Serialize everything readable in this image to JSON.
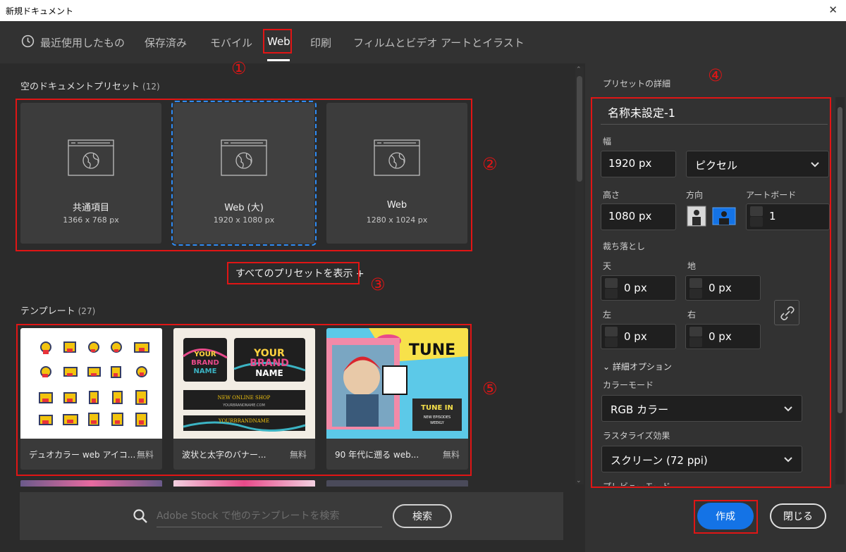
{
  "window": {
    "title": "新規ドキュメント",
    "close_glyph": "✕"
  },
  "tabs": [
    {
      "label": "最近使用したもの",
      "icon": "clock-icon"
    },
    {
      "label": "保存済み"
    },
    {
      "label": "モバイル"
    },
    {
      "label": "Web",
      "active": true
    },
    {
      "label": "印刷"
    },
    {
      "label": "フィルムとビデオ"
    },
    {
      "label": "アートとイラスト"
    }
  ],
  "presets": {
    "heading": "空のドキュメントプリセット",
    "count": "(12)",
    "items": [
      {
        "name": "共通項目",
        "size": "1366 x 768 px"
      },
      {
        "name": "Web (大)",
        "size": "1920 x 1080 px",
        "selected": true
      },
      {
        "name": "Web",
        "size": "1280 x 1024 px"
      }
    ],
    "show_all": "すべてのプリセットを表示 +"
  },
  "templates": {
    "heading": "テンプレート",
    "count": "(27)",
    "items": [
      {
        "name": "デュオカラー web アイコ...",
        "price": "無料"
      },
      {
        "name": "波状と太字のバナー...",
        "price": "無料"
      },
      {
        "name": "90 年代に遡る web...",
        "price": "無料"
      }
    ],
    "img2": {
      "line1": "YOUR",
      "line2": "BRAND",
      "line3": "NAME",
      "banner": "NEW ONLINE SHOP",
      "url": "YOURBRANDNAME.COM",
      "bottom": "YOURBRANDNAME"
    },
    "img3": {
      "tune": "TUNE",
      "tunein_1": "TUNE IN",
      "tunein_2": "NEW EPISODES",
      "tunein_3": "WEEKLY"
    }
  },
  "search": {
    "placeholder": "Adobe Stock で他のテンプレートを検索",
    "button": "検索"
  },
  "annotations": [
    "①",
    "②",
    "③",
    "④",
    "⑤"
  ],
  "details": {
    "heading": "プリセットの詳細",
    "doc_name": "名称未設定-1",
    "width_label": "幅",
    "width_value": "1920 px",
    "unit": "ピクセル",
    "height_label": "高さ",
    "height_value": "1080 px",
    "orientation_label": "方向",
    "artboard_label": "アートボード",
    "artboard_value": "1",
    "bleed_label": "裁ち落とし",
    "top_label": "天",
    "top_value": "0 px",
    "bottom_label": "地",
    "bottom_value": "0 px",
    "left_label": "左",
    "left_value": "0 px",
    "right_label": "右",
    "right_value": "0 px",
    "advanced_label": "詳細オプション",
    "color_mode_label": "カラーモード",
    "color_mode_value": "RGB カラー",
    "raster_label": "ラスタライズ効果",
    "raster_value": "スクリーン (72 ppi)",
    "preview_label": "プレビューモード"
  },
  "actions": {
    "create": "作成",
    "close": "閉じる"
  },
  "colors": {
    "accent": "#1473e6",
    "annotation": "#e01515",
    "selection": "#2f8cf5"
  }
}
